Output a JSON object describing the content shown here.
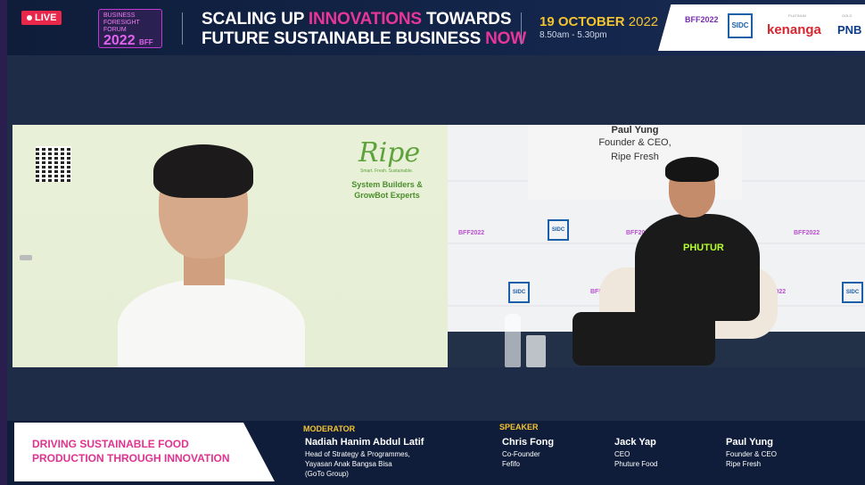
{
  "live_badge": "LIVE",
  "event_logo": {
    "line1": "BUSINESS",
    "line2": "FORESIGHT",
    "line3": "FORUM",
    "year": "2022",
    "mark": "BFF"
  },
  "headline": {
    "line1_part1": "SCALING UP ",
    "line1_highlight": "INNOVATIONS",
    "line1_part2": " TOWARDS",
    "line2_part1": "FUTURE SUSTAINABLE BUSINESS ",
    "line2_highlight": "NOW"
  },
  "date": {
    "day_month": "19 OCTOBER",
    "year": "2022"
  },
  "time": "8.50am - 5.30pm",
  "sponsors": {
    "bff": "BFF2022",
    "sidc": "SIDC",
    "kenanga": "kenanga",
    "pnb": "PNB",
    "platinum_label": "PLATINUM",
    "gold_label": "GOLD"
  },
  "left_video": {
    "brand": "Ripe",
    "brand_tagline": "Smart. Fresh. Sustainable.",
    "slogan_line1": "System Builders &",
    "slogan_line2": "GrowBot Experts"
  },
  "right_video": {
    "speaker_name": "Paul Yung",
    "speaker_role1": "Founder & CEO,",
    "speaker_role2": "Ripe Fresh",
    "shirt_text": "PHUTUR",
    "backdrop_bff": "BFF2022",
    "backdrop_sidc": "SIDC"
  },
  "lower_third": {
    "topic_line1": "DRIVING SUSTAINABLE FOOD",
    "topic_line2": "PRODUCTION THROUGH INNOVATION",
    "moderator_label": "MODERATOR",
    "moderator": {
      "name": "Nadiah Hanim Abdul Latif",
      "role1": "Head of Strategy & Programmes,",
      "role2": "Yayasan Anak Bangsa Bisa",
      "role3": "(GoTo Group)"
    },
    "speaker_label": "SPEAKER",
    "speakers": [
      {
        "name": "Chris Fong",
        "role1": "Co-Founder",
        "role2": "Fefifo"
      },
      {
        "name": "Jack Yap",
        "role1": "CEO",
        "role2": "Phuture Food"
      },
      {
        "name": "Paul Yung",
        "role1": "Founder & CEO",
        "role2": "Ripe Fresh"
      }
    ]
  },
  "colors": {
    "live_red": "#e8274b",
    "highlight_pink": "#e8359a",
    "date_gold": "#f4c430",
    "navy": "#0f1d3a",
    "ripe_green": "#5da23a"
  }
}
